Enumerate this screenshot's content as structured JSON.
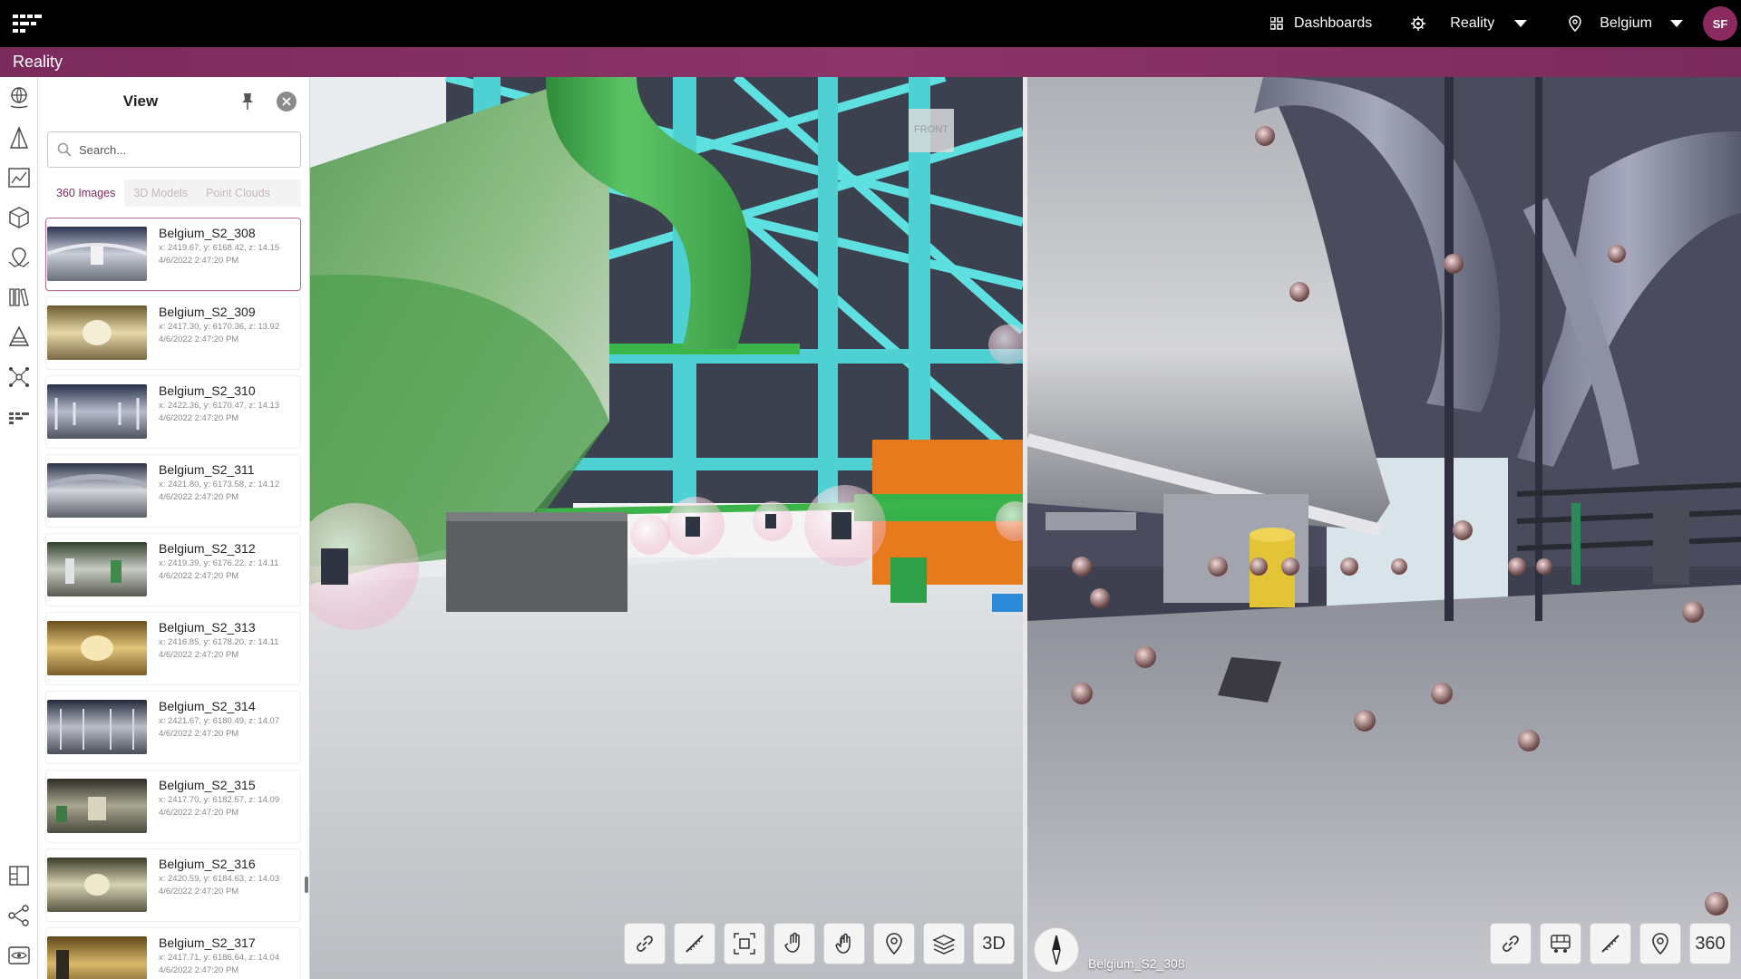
{
  "topbar": {
    "dashboards_label": "Dashboards",
    "app_select": "Reality",
    "location_select": "Belgium",
    "user_initials": "SF"
  },
  "subbar": {
    "title": "Reality"
  },
  "panel": {
    "title": "View",
    "search_placeholder": "Search...",
    "tabs": [
      {
        "label": "360 Images"
      },
      {
        "label": "3D Models"
      },
      {
        "label": "Point Clouds"
      }
    ],
    "items": [
      {
        "name": "Belgium_S2_308",
        "coords": "x: 2419.67, y: 6168.42, z: 14.15",
        "date": "4/6/2022 2:47:20 PM"
      },
      {
        "name": "Belgium_S2_309",
        "coords": "x: 2417.30, y: 6170.36, z: 13.92",
        "date": "4/6/2022 2:47:20 PM"
      },
      {
        "name": "Belgium_S2_310",
        "coords": "x: 2422.36, y: 6170.47, z: 14.13",
        "date": "4/6/2022 2:47:20 PM"
      },
      {
        "name": "Belgium_S2_311",
        "coords": "x: 2421.80, y: 6173.58, z: 14.12",
        "date": "4/6/2022 2:47:20 PM"
      },
      {
        "name": "Belgium_S2_312",
        "coords": "x: 2419.39, y: 6176.22, z: 14.11",
        "date": "4/6/2022 2:47:20 PM"
      },
      {
        "name": "Belgium_S2_313",
        "coords": "x: 2416.85, y: 6178.20, z: 14.11",
        "date": "4/6/2022 2:47:20 PM"
      },
      {
        "name": "Belgium_S2_314",
        "coords": "x: 2421.67, y: 6180.49, z: 14.07",
        "date": "4/6/2022 2:47:20 PM"
      },
      {
        "name": "Belgium_S2_315",
        "coords": "x: 2417.70, y: 6182.57, z: 14.09",
        "date": "4/6/2022 2:47:20 PM"
      },
      {
        "name": "Belgium_S2_316",
        "coords": "x: 2420.59, y: 6184.63, z: 14.03",
        "date": "4/6/2022 2:47:20 PM"
      },
      {
        "name": "Belgium_S2_317",
        "coords": "x: 2417.71, y: 6186.64, z: 14.04",
        "date": "4/6/2022 2:47:20 PM"
      }
    ]
  },
  "left_view": {
    "cube_label": "FRONT",
    "mode_button": "3D"
  },
  "right_view": {
    "pano_name": "Belgium_S2_308",
    "mode_button": "360"
  },
  "colors": {
    "brand": "#7b2a5c",
    "topbar": "#000000",
    "pipe_green": "#3fae4b",
    "steel_cyan": "#4fd6d6"
  }
}
